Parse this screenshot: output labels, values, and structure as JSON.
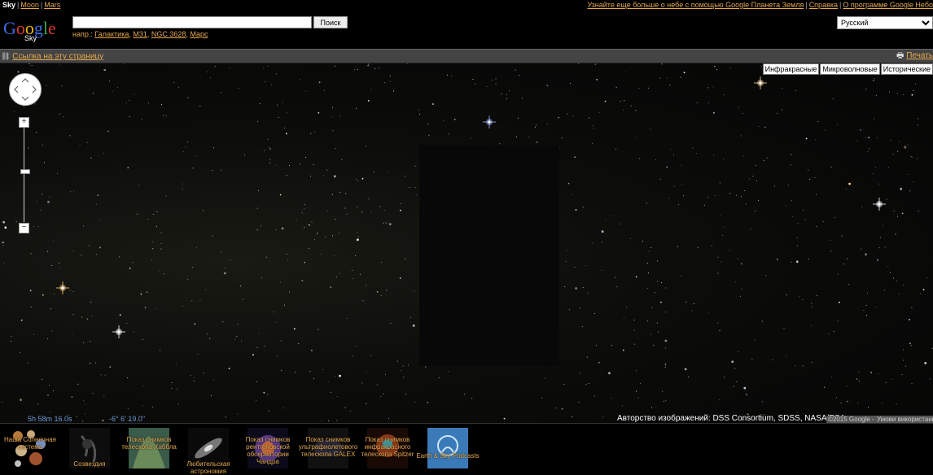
{
  "topbar": {
    "sky": "Sky",
    "moon": "Moon",
    "mars": "Mars",
    "right_links": [
      "Узнайте еще больше о небе с помощью Google Планета Земля",
      "Справка",
      "О программе Google Небо"
    ]
  },
  "header": {
    "logo_text": "Google",
    "logo_sub": "Sky",
    "search_value": "",
    "search_button": "Поиск",
    "examples_prefix": "напр.:",
    "examples": [
      "Галактика",
      "M31",
      "NGC 3628",
      "Марс"
    ],
    "language": "Русский"
  },
  "linkbar": {
    "link_text": "Ссылка на эту страницу",
    "print_text": "Печать"
  },
  "map": {
    "layers": [
      "Инфракрасные",
      "Микроволновые",
      "Исторические"
    ],
    "ra": "5h 58m 16.0s",
    "dec": "-6° 6' 19.0\"",
    "credit": "Авторство изображений: DSS Consortium, SDSS, NASA/ESA",
    "copyright": "©2015 Google -",
    "terms": "Умови використання"
  },
  "gallery": [
    {
      "label": "Наша Солнечная система",
      "icon": "solar-system-icon"
    },
    {
      "label": "Созвездия",
      "icon": "constellation-icon"
    },
    {
      "label": "Показ снимков телескопа Хаббла",
      "icon": "hubble-icon"
    },
    {
      "label": "Любительская астрономия",
      "icon": "galaxy-icon"
    },
    {
      "label": "Показ снимков рентгеновской обсерватории Чандра",
      "icon": "chandra-icon"
    },
    {
      "label": "Показ снимков ультрафиолетового телескопа GALEX",
      "icon": "galex-icon"
    },
    {
      "label": "Показ снимков инфракрасного телескопа Spitzer",
      "icon": "spitzer-icon"
    },
    {
      "label": "Earth & Sky Podcasts",
      "icon": "podcast-icon"
    }
  ],
  "colors": {
    "link": "#e4a74e",
    "coords": "#6b9bd6"
  }
}
